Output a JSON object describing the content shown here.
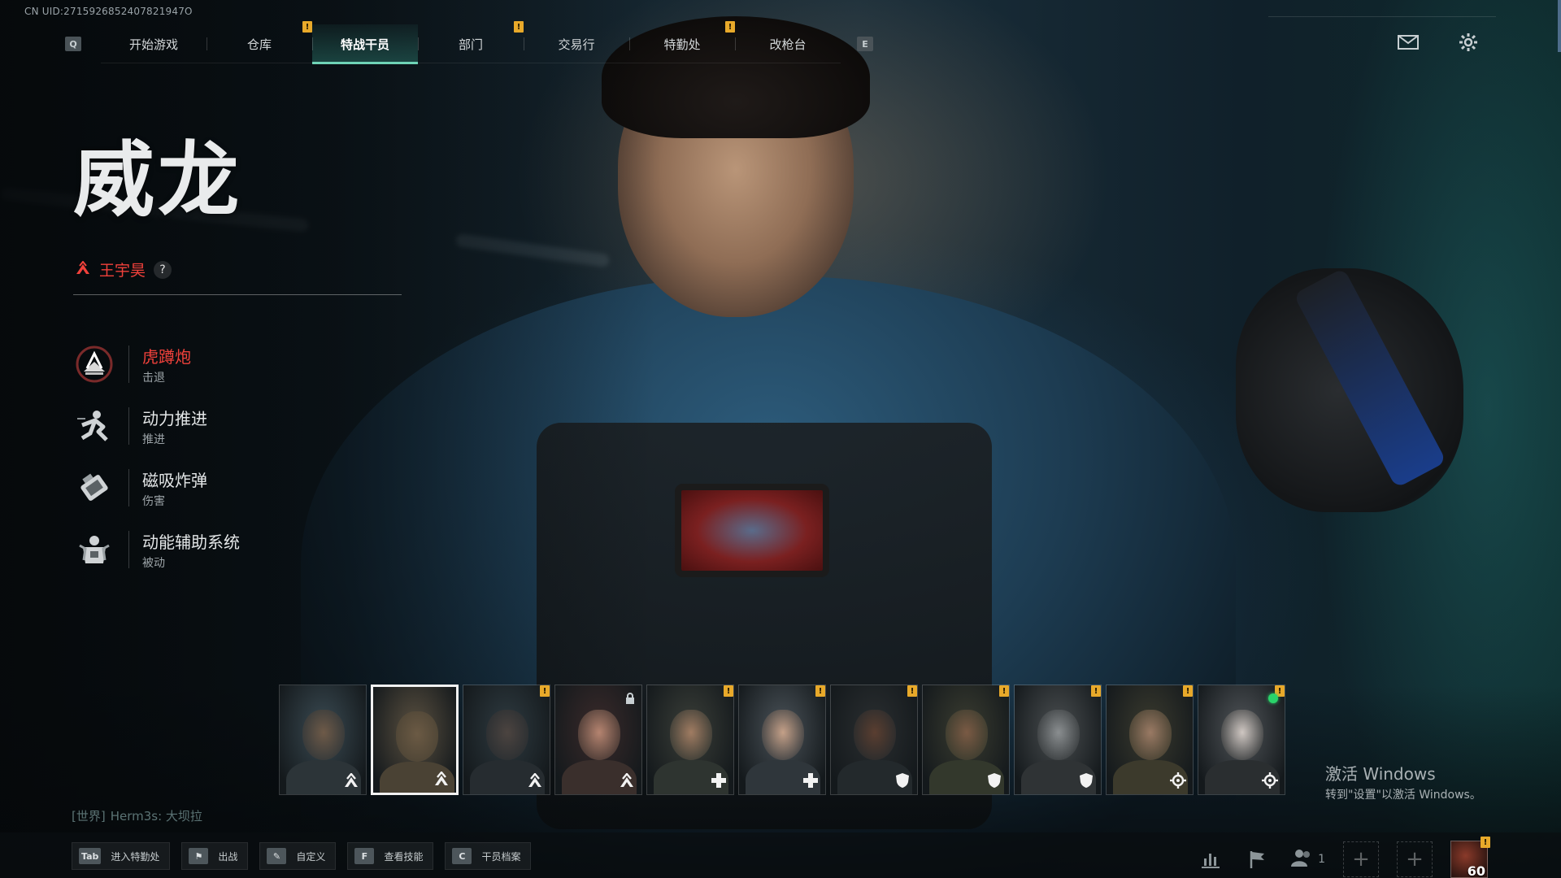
{
  "uid": "CN UID:2715926852407821947O",
  "nav": {
    "left_key": "Q",
    "right_key": "E",
    "tabs": [
      {
        "label": "开始游戏",
        "notif": false,
        "active": false
      },
      {
        "label": "仓库",
        "notif": true,
        "active": false
      },
      {
        "label": "特战干员",
        "notif": false,
        "active": true
      },
      {
        "label": "部门",
        "notif": true,
        "active": false
      },
      {
        "label": "交易行",
        "notif": false,
        "active": false
      },
      {
        "label": "特勤处",
        "notif": true,
        "active": false
      },
      {
        "label": "改枪台",
        "notif": false,
        "active": false
      }
    ],
    "notif_mark": "!",
    "icons": [
      "mail-icon",
      "gear-icon"
    ]
  },
  "operator": {
    "name": "威龙",
    "actor_name": "王宇昊",
    "help": "?",
    "skills": [
      {
        "name": "虎蹲炮",
        "type": "击退",
        "icon": "mortar-icon",
        "active": true
      },
      {
        "name": "动力推进",
        "type": "推进",
        "icon": "dash-icon",
        "active": false
      },
      {
        "name": "磁吸炸弹",
        "type": "伤害",
        "icon": "magnetic-bomb-icon",
        "active": false
      },
      {
        "name": "动能辅助系统",
        "type": "被动",
        "icon": "exosuit-icon",
        "active": false
      }
    ]
  },
  "roster": [
    {
      "role": "assault",
      "selected": false,
      "notif": false,
      "locked": false,
      "online": false
    },
    {
      "role": "assault",
      "selected": true,
      "notif": false,
      "locked": false,
      "online": false
    },
    {
      "role": "assault",
      "selected": false,
      "notif": true,
      "locked": false,
      "online": false
    },
    {
      "role": "assault",
      "selected": false,
      "notif": false,
      "locked": true,
      "online": false
    },
    {
      "role": "support",
      "selected": false,
      "notif": true,
      "locked": false,
      "online": false
    },
    {
      "role": "support",
      "selected": false,
      "notif": true,
      "locked": false,
      "online": false
    },
    {
      "role": "engineer",
      "selected": false,
      "notif": true,
      "locked": false,
      "online": false
    },
    {
      "role": "engineer",
      "selected": false,
      "notif": true,
      "locked": false,
      "online": false
    },
    {
      "role": "engineer",
      "selected": false,
      "notif": true,
      "locked": false,
      "online": false
    },
    {
      "role": "recon",
      "selected": false,
      "notif": true,
      "locked": false,
      "online": false
    },
    {
      "role": "recon",
      "selected": false,
      "notif": true,
      "locked": false,
      "online": true
    }
  ],
  "chat": {
    "channel": "[世界]",
    "message": "Herm3s: 大坝拉"
  },
  "watermark": {
    "line1": "激活 Windows",
    "line2": "转到\"设置\"以激活 Windows。"
  },
  "bottom": {
    "actions": [
      {
        "key": "Tab",
        "label": "进入特勤处"
      },
      {
        "key": "⚑",
        "label": "出战"
      },
      {
        "key": "✎",
        "label": "自定义"
      },
      {
        "key": "F",
        "label": "查看技能"
      },
      {
        "key": "C",
        "label": "干员档案"
      }
    ],
    "party_count": "1",
    "add_slot": "+",
    "player_level": "60"
  },
  "colors": {
    "accent": "#6fd3b6",
    "highlight_red": "#f0413b",
    "notif": "#e8a92a",
    "online": "#2ad36a"
  }
}
